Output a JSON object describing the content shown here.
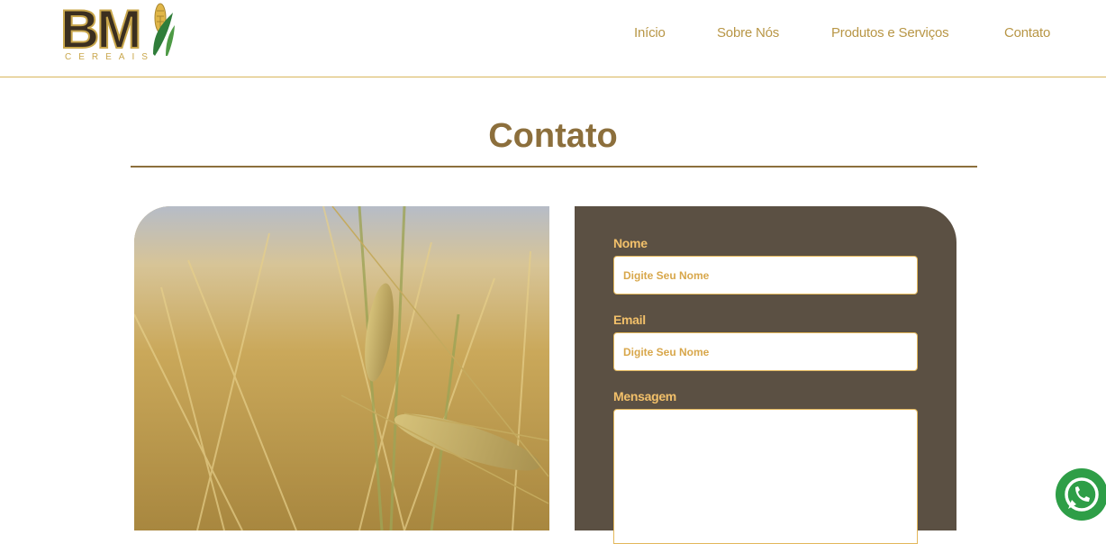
{
  "brand": {
    "logo_text": "BM",
    "logo_subtext": "CEREAIS"
  },
  "nav": {
    "items": [
      {
        "label": "Início",
        "active": false
      },
      {
        "label": "Sobre Nós",
        "active": false
      },
      {
        "label": "Produtos e Serviços",
        "active": true
      },
      {
        "label": "Contato",
        "active": false
      }
    ]
  },
  "page": {
    "title": "Contato"
  },
  "form": {
    "name_label": "Nome",
    "name_placeholder": "Digite Seu Nome",
    "email_label": "Email",
    "email_placeholder": "Digite Seu Nome",
    "message_label": "Mensagem",
    "message_placeholder": ""
  },
  "colors": {
    "accent": "#b89646",
    "title": "#8c6f3c",
    "form_bg": "#5b5043",
    "form_label": "#f2c06a",
    "whatsapp": "#2e9e47"
  },
  "icons": {
    "floating": "whatsapp-icon",
    "logo_mark": "corn-icon"
  }
}
